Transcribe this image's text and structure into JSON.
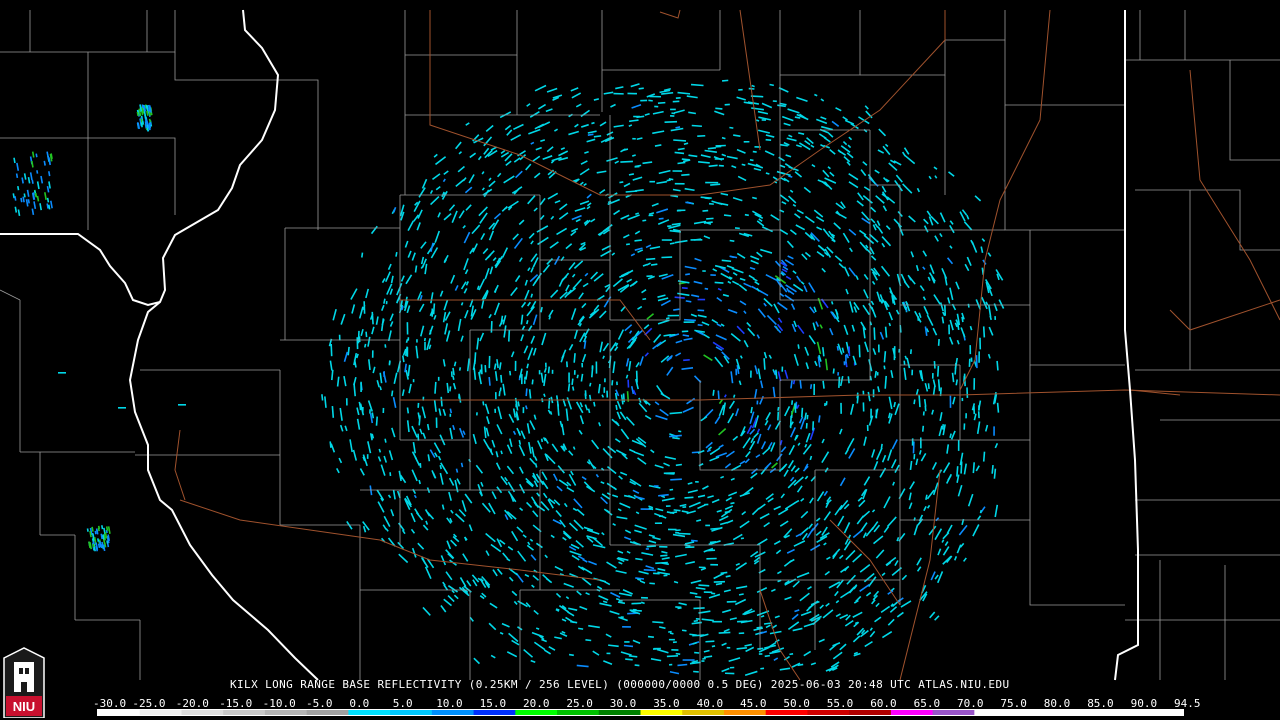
{
  "header": {
    "product_line": "KILX LONG RANGE BASE REFLECTIVITY (0.25KM / 256 LEVEL) (000000/0000 0.5 DEG) 2025-06-03 20:48 UTC  ATLAS.NIU.EDU"
  },
  "logo": {
    "text": "NIU",
    "colors": {
      "red": "#c8102e",
      "white": "#ffffff",
      "dark": "#1a1a1a"
    }
  },
  "map": {
    "background": "#000000",
    "state_border_color": "#ffffff",
    "county_border_color": "#9a9a9a",
    "highway_color": "#a0522d",
    "radar_site": "KILX"
  },
  "color_scale": {
    "labels": [
      "-30.0",
      "-25.0",
      "-20.0",
      "-15.0",
      "-10.0",
      "-5.0",
      "0.0",
      "5.0",
      "10.0",
      "15.0",
      "20.0",
      "25.0",
      "30.0",
      "35.0",
      "40.0",
      "45.0",
      "50.0",
      "55.0",
      "60.0",
      "65.0",
      "70.0",
      "75.0",
      "80.0",
      "85.0",
      "90.0",
      "94.5"
    ],
    "colors": [
      "#ffffff",
      "#f0f0f0",
      "#dcdcdc",
      "#c8c8c8",
      "#b4b4b4",
      "#a0a0a0",
      "#00e0ff",
      "#00c8ff",
      "#0090ff",
      "#0030ff",
      "#00ff00",
      "#00c000",
      "#008000",
      "#ffff00",
      "#e0c000",
      "#ff9000",
      "#ff0000",
      "#d00000",
      "#b00000",
      "#ff00ff",
      "#9955c9",
      "#ffffff",
      "#ffffff",
      "#ffffff",
      "#ffffff",
      "#ffffff"
    ]
  }
}
